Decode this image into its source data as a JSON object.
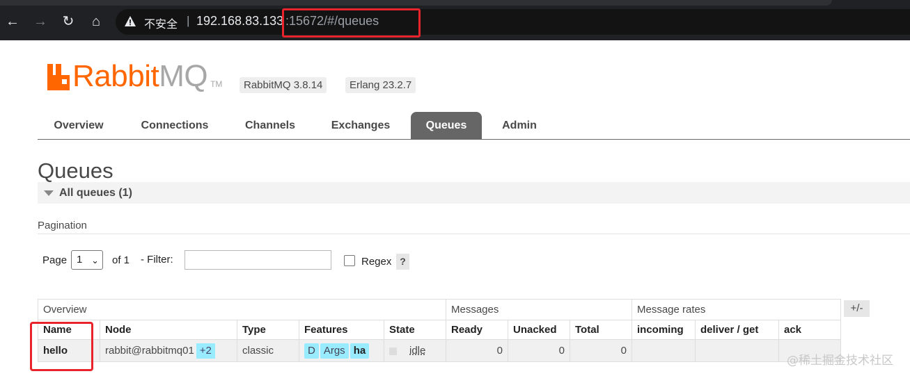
{
  "browser": {
    "insecure_label": "不安全",
    "separator": "|",
    "url_host": "192.168.83.133",
    "url_rest": ":15672/#/queues"
  },
  "header": {
    "logo_rabbit": "Rabbit",
    "logo_mq": "MQ",
    "logo_tm": "TM",
    "version": "RabbitMQ 3.8.14",
    "erlang": "Erlang 23.2.7",
    "accent_color": "#ff6600"
  },
  "tabs": [
    {
      "label": "Overview",
      "active": false
    },
    {
      "label": "Connections",
      "active": false
    },
    {
      "label": "Channels",
      "active": false
    },
    {
      "label": "Exchanges",
      "active": false
    },
    {
      "label": "Queues",
      "active": true
    },
    {
      "label": "Admin",
      "active": false
    }
  ],
  "page": {
    "title": "Queues",
    "section_title": "All queues (1)",
    "pagination_label": "Pagination",
    "page_label": "Page",
    "page_value": "1",
    "of_label": "of 1",
    "filter_label": "- Filter:",
    "filter_value": "",
    "regex_label": "Regex",
    "help_label": "?",
    "plusminus": "+/-"
  },
  "table": {
    "groups": [
      "Overview",
      "Messages",
      "Message rates"
    ],
    "columns": [
      "Name",
      "Node",
      "Type",
      "Features",
      "State",
      "Ready",
      "Unacked",
      "Total",
      "incoming",
      "deliver / get",
      "ack"
    ],
    "rows": [
      {
        "name": "hello",
        "node": "rabbit@rabbitmq01",
        "node_extra": "+2",
        "type": "classic",
        "features": [
          "D",
          "Args",
          "ha"
        ],
        "state": "idle",
        "ready": "0",
        "unacked": "0",
        "total": "0",
        "incoming": "",
        "deliver_get": "",
        "ack": ""
      }
    ]
  },
  "watermark": "@稀土掘金技术社区"
}
